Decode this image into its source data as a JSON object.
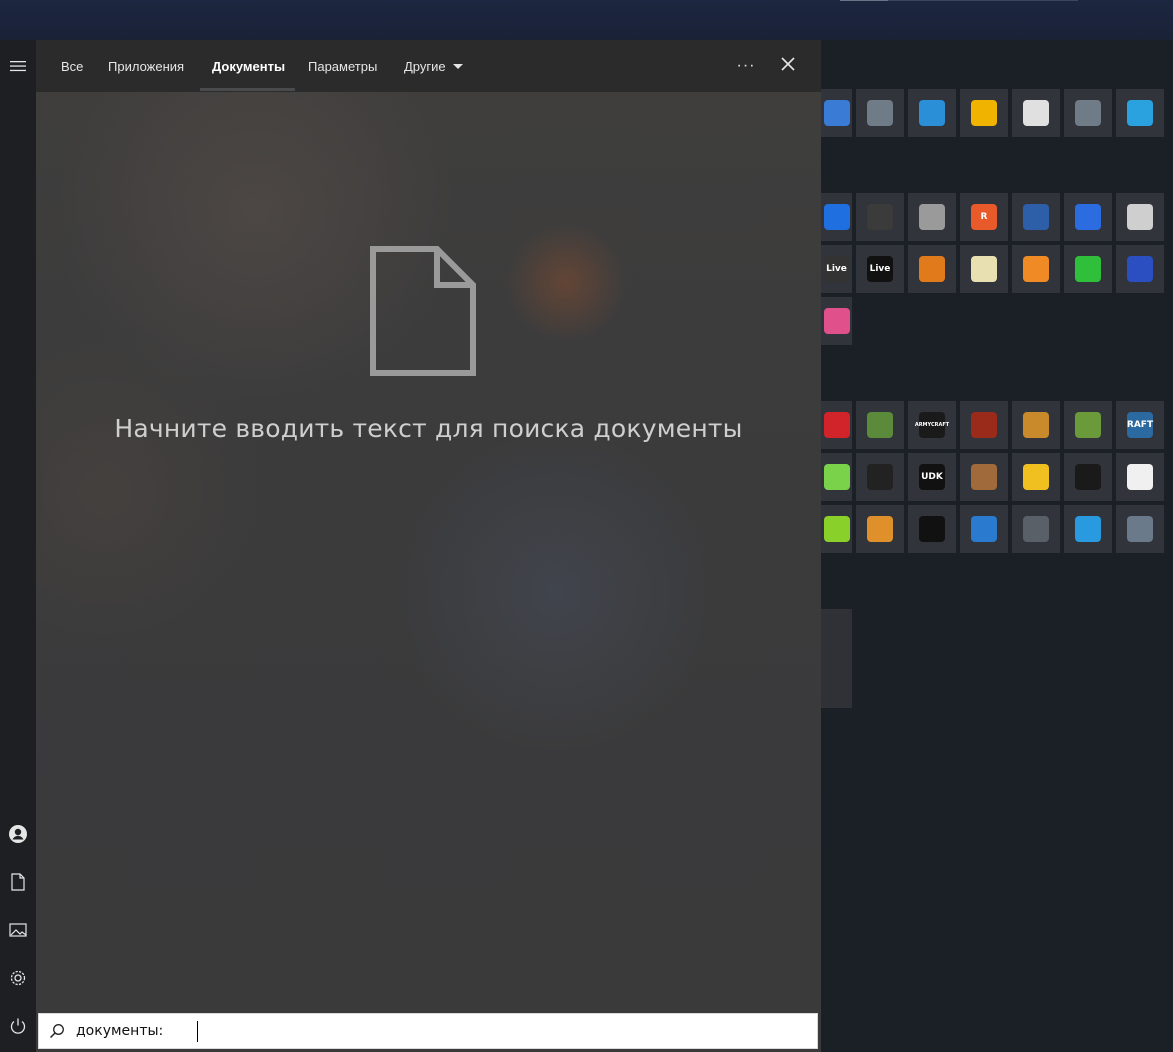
{
  "panel": {
    "tabs": [
      {
        "label": "Все"
      },
      {
        "label": "Приложения"
      },
      {
        "label": "Документы"
      },
      {
        "label": "Параметры"
      },
      {
        "label": "Другие"
      }
    ],
    "active_tab": "Документы",
    "more_label": "···",
    "empty_message": "Начните вводить текст для поиска документы"
  },
  "search": {
    "value": "документы:"
  },
  "rail": {
    "items": [
      "hamburger-menu-icon",
      "user-icon",
      "document-icon",
      "pictures-icon",
      "settings-icon",
      "power-icon"
    ]
  },
  "tiles": [
    {
      "name": "this-pc",
      "label": "",
      "color": "#3a7bd5"
    },
    {
      "name": "mixer",
      "label": "",
      "color": "#6f7b86"
    },
    {
      "name": "network",
      "label": "",
      "color": "#2b8fd8"
    },
    {
      "name": "file-explorer",
      "label": "",
      "color": "#f0b400"
    },
    {
      "name": "microsoft-store",
      "label": "",
      "color": "#e0e0e0"
    },
    {
      "name": "mixer-2",
      "label": "",
      "color": "#6f7b86"
    },
    {
      "name": "health",
      "label": "",
      "color": "#2aa2e0"
    },
    {
      "name": "dropbox",
      "label": "",
      "color": "#1f6fe0"
    },
    {
      "name": "davinci-resolve",
      "label": "",
      "color": "#3b3b3b"
    },
    {
      "name": "final-draft",
      "label": "",
      "color": "#9a9a9a"
    },
    {
      "name": "reaper",
      "label": "R",
      "color": "#e85a2a"
    },
    {
      "name": "cinema4d",
      "label": "",
      "color": "#2c5fa8"
    },
    {
      "name": "todo",
      "label": "",
      "color": "#2b6ce0"
    },
    {
      "name": "blocks",
      "label": "",
      "color": "#cfcfcf"
    },
    {
      "name": "ableton-live-1",
      "label": "Live",
      "color": "#333333"
    },
    {
      "name": "ableton-live-2",
      "label": "Live",
      "color": "#111111"
    },
    {
      "name": "fl-studio",
      "label": "",
      "color": "#e07a1a"
    },
    {
      "name": "notes",
      "label": "",
      "color": "#e8e0b0"
    },
    {
      "name": "blender",
      "label": "",
      "color": "#f08a24"
    },
    {
      "name": "green-app",
      "label": "",
      "color": "#2fbf3a"
    },
    {
      "name": "audio-app",
      "label": "",
      "color": "#2b4fc0"
    },
    {
      "name": "figma",
      "label": "",
      "color": "#e0508a"
    },
    {
      "name": "game-red",
      "label": "",
      "color": "#d0242a"
    },
    {
      "name": "minecraft-small",
      "label": "",
      "color": "#5a8a3a"
    },
    {
      "name": "armycraft",
      "label": "ARMYCRAFT",
      "color": "#1a1a1a"
    },
    {
      "name": "red-dead",
      "label": "",
      "color": "#9a2a1a"
    },
    {
      "name": "counter-strike",
      "label": "",
      "color": "#c88a2a"
    },
    {
      "name": "minecraft-big",
      "label": "",
      "color": "#6a9a3a"
    },
    {
      "name": "raft",
      "label": "RAFT",
      "color": "#2a6aa0"
    },
    {
      "name": "green-tag",
      "label": "",
      "color": "#7ad24a"
    },
    {
      "name": "unity",
      "label": "",
      "color": "#222222"
    },
    {
      "name": "udk",
      "label": "UDK",
      "color": "#111111"
    },
    {
      "name": "western",
      "label": "",
      "color": "#a06a3a"
    },
    {
      "name": "radiation",
      "label": "",
      "color": "#f0c020"
    },
    {
      "name": "dark-orb",
      "label": "",
      "color": "#1a1a1a"
    },
    {
      "name": "warning-sign",
      "label": "",
      "color": "#f0f0f0"
    },
    {
      "name": "android-green",
      "label": "",
      "color": "#8ad02a"
    },
    {
      "name": "bus",
      "label": "",
      "color": "#e0902a"
    },
    {
      "name": "unreal",
      "label": "",
      "color": "#111111"
    },
    {
      "name": "window-app",
      "label": "",
      "color": "#2a7ad0"
    },
    {
      "name": "panel-app",
      "label": "",
      "color": "#5a6068"
    },
    {
      "name": "bird-app",
      "label": "",
      "color": "#2a9ae0"
    },
    {
      "name": "cube-app",
      "label": "",
      "color": "#6a7a8a"
    }
  ]
}
